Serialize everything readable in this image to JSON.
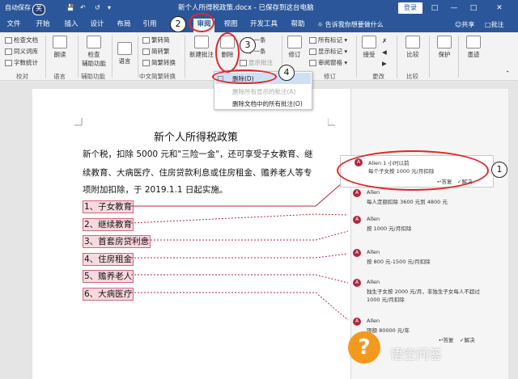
{
  "titlebar": {
    "autosave": "自动保存",
    "toggle": "关",
    "document_title": "新个人所得税政策.docx - 已保存到这台电脑",
    "login": "登录"
  },
  "tabs": [
    "文件",
    "开始",
    "插入",
    "设计",
    "布局",
    "引用",
    "邮件",
    "审阅",
    "视图",
    "开发工具",
    "帮助"
  ],
  "active_tab": "审阅",
  "tell_me": "告诉我你想要做什么",
  "share": "共享",
  "comment_btn": "批注",
  "ribbon": {
    "proofing": {
      "items": [
        "检查文档",
        "同义词库",
        "字数统计"
      ],
      "label": "校对"
    },
    "language_read": "朗读",
    "language": {
      "label": "语言",
      "btn": "语言"
    },
    "accessibility": {
      "btn_line1": "检查",
      "btn_line2": "辅助功能",
      "label": "辅助功能"
    },
    "chinese": {
      "items": [
        "繁转简",
        "简转繁",
        "简繁转换"
      ],
      "label": "中文简繁转换"
    },
    "comments": {
      "new": "新建批注",
      "delete": "删除",
      "prev": "上一条",
      "next": "下一条",
      "show": "显示批注"
    },
    "tracking": {
      "revise": "修订",
      "all_markup": "所有标记",
      "show_markup": "显示标记",
      "pane": "审阅窗格",
      "label": "修订"
    },
    "changes": {
      "accept": "接受",
      "label": "更改"
    },
    "compare": {
      "btn": "比较",
      "label": "比较"
    },
    "protect": {
      "btn": "保护"
    },
    "ink": {
      "btn": "墨迹"
    }
  },
  "dropdown": {
    "items": [
      "删除(D)",
      "删除所有显示的批注(A)",
      "删除文档中的所有批注(O)"
    ]
  },
  "document": {
    "title": "新个人所得税政策",
    "para_lines": [
      "新个税，扣除 5000 元和\"三险一金\"，还可享受子女教育、继",
      "续教育、大病医疗、住房贷款利息或住房租金、赡养老人等专",
      "项附加扣除，于 2019.1.1 日起实施。"
    ],
    "list": [
      "1、子女教育",
      "2、继续教育",
      "3、首套房贷利息",
      "4、住房租金",
      "5、赡养老人",
      "6、大病医疗"
    ]
  },
  "comments": [
    {
      "author": "Allen",
      "time": "1 小时以前",
      "text": "每个子女按 1000 元/月扣除"
    },
    {
      "author": "Allen",
      "time": "",
      "text": "每人定额扣除 3600 元到 4800 元"
    },
    {
      "author": "Allen",
      "time": "",
      "text": "按 1000 元/月扣除"
    },
    {
      "author": "Allen",
      "time": "",
      "text": "按 800 元-1500 元/月扣除"
    },
    {
      "author": "Allen",
      "time": "",
      "text": "独生子女按 2000 元/月，非独生子女每人不超过"
    },
    {
      "author": "Allen",
      "time": "",
      "text": "限额 80000 元/年"
    }
  ],
  "comment_extra_line": "1000 元/月扣除",
  "comment_actions": {
    "reply": "答复",
    "resolve": "解决"
  },
  "comment_actions_last": {
    "reply": "答复",
    "resolve": "解决"
  },
  "annotations": [
    "1",
    "2",
    "3",
    "4"
  ],
  "watermark": "悟空问答",
  "colors": {
    "accent": "#2b579a",
    "highlight": "#e0262b",
    "comment_mark": "#b0283c"
  }
}
